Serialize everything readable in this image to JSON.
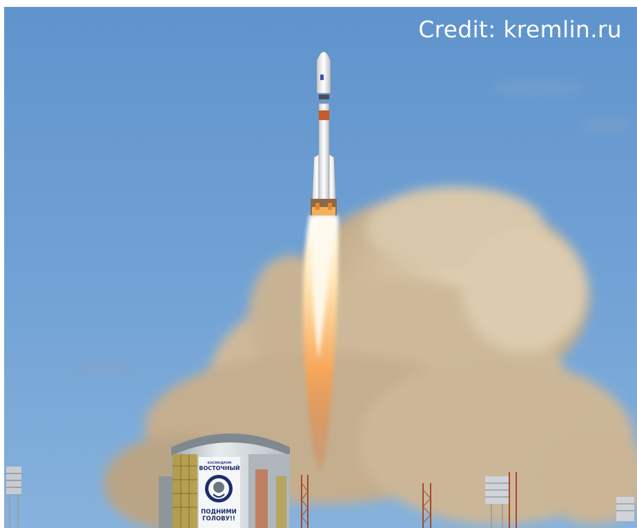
{
  "credit": "Credit: kremlin.ru",
  "sign": {
    "top_small": "КОСМОДРОМ",
    "name": "ВОСТОЧНЫЙ",
    "slogan_line1": "ПОДНИМИ",
    "slogan_line2": "ГОЛОВУ!!"
  },
  "colors": {
    "sky": "#6f9fd2",
    "smoke": "#c9b79a",
    "flame": "#ffe6b0",
    "credit_text": "#ffffff"
  }
}
